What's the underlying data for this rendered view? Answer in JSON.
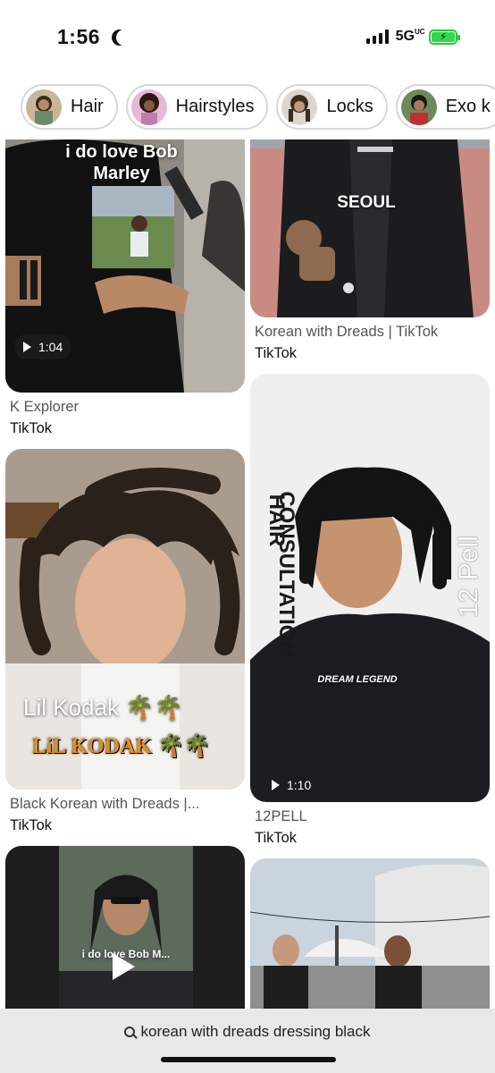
{
  "status_bar": {
    "time": "1:56",
    "network": "5G",
    "network_suffix": "UC"
  },
  "chips": [
    {
      "label": "Hair"
    },
    {
      "label": "Hairstyles"
    },
    {
      "label": "Locks"
    },
    {
      "label": "Exo k"
    }
  ],
  "pins": {
    "p1": {
      "overlay": "i do love Bob Marley",
      "duration": "1:04",
      "title": "K Explorer",
      "source": "TikTok"
    },
    "p2": {
      "overlay": "SEOUL",
      "title": "Korean with Dreads | TikTok",
      "source": "TikTok"
    },
    "p3": {
      "overlay1": "Lil Kodak 🌴🌴",
      "overlay2": "LiL KODAK 🌴🌴",
      "title": "Black Korean with Dreads |...",
      "source": "TikTok"
    },
    "p4": {
      "overlay1": "HAIR",
      "overlay2": "CONSULTATION",
      "overlay3": "12 Pell",
      "shirt": "DREAM LEGEND",
      "duration": "1:10",
      "title": "12PELL",
      "source": "TikTok"
    },
    "p5": {
      "overlay": "i do love Bob M..."
    },
    "p6": {}
  },
  "search": {
    "query": "korean with dreads dressing black"
  },
  "colors": {
    "chip_border": "#d7d7d7",
    "battery": "#32d74b",
    "search_bg": "#e8e8e8"
  }
}
